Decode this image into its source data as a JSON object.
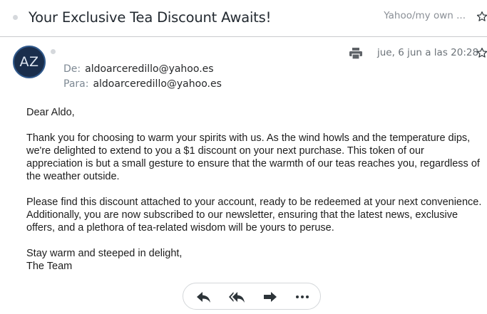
{
  "message": {
    "subject": "Your Exclusive Tea Discount Awaits!",
    "folder": "Yahoo/my own ...",
    "avatar_initials": "AZ",
    "from_label": "De:",
    "from_value": "aldoarceredillo@yahoo.es",
    "to_label": "Para:",
    "to_value": "aldoarceredillo@yahoo.es",
    "date": "jue, 6 jun a las 20:28"
  },
  "body": {
    "greeting": "Dear Aldo,",
    "paragraph1": "Thank you for choosing to warm your spirits with us. As the wind howls and the temperature dips, we're delighted to extend to you a $1 discount on your next purchase. This token of our appreciation is but a small gesture to ensure that the warmth of our teas reaches you, regardless of the weather outside.",
    "paragraph2": "Please find this discount attached to your account, ready to be redeemed at your next convenience. Additionally, you are now subscribed to our newsletter, ensuring that the latest news, exclusive offers, and a plethora of tea-related wisdom will be yours to peruse.",
    "closing": "Stay warm and steeped in delight,",
    "signature": "The Team"
  },
  "icons": {
    "star": "star-icon",
    "print": "print-icon",
    "reply": "reply-icon",
    "reply_all": "reply-all-icon",
    "forward": "forward-icon",
    "more": "more-icon"
  },
  "colors": {
    "avatar_bg": "#1a2e4c",
    "avatar_border": "#30598c",
    "label_gray": "#7d8893",
    "divider": "#c9cbce"
  }
}
